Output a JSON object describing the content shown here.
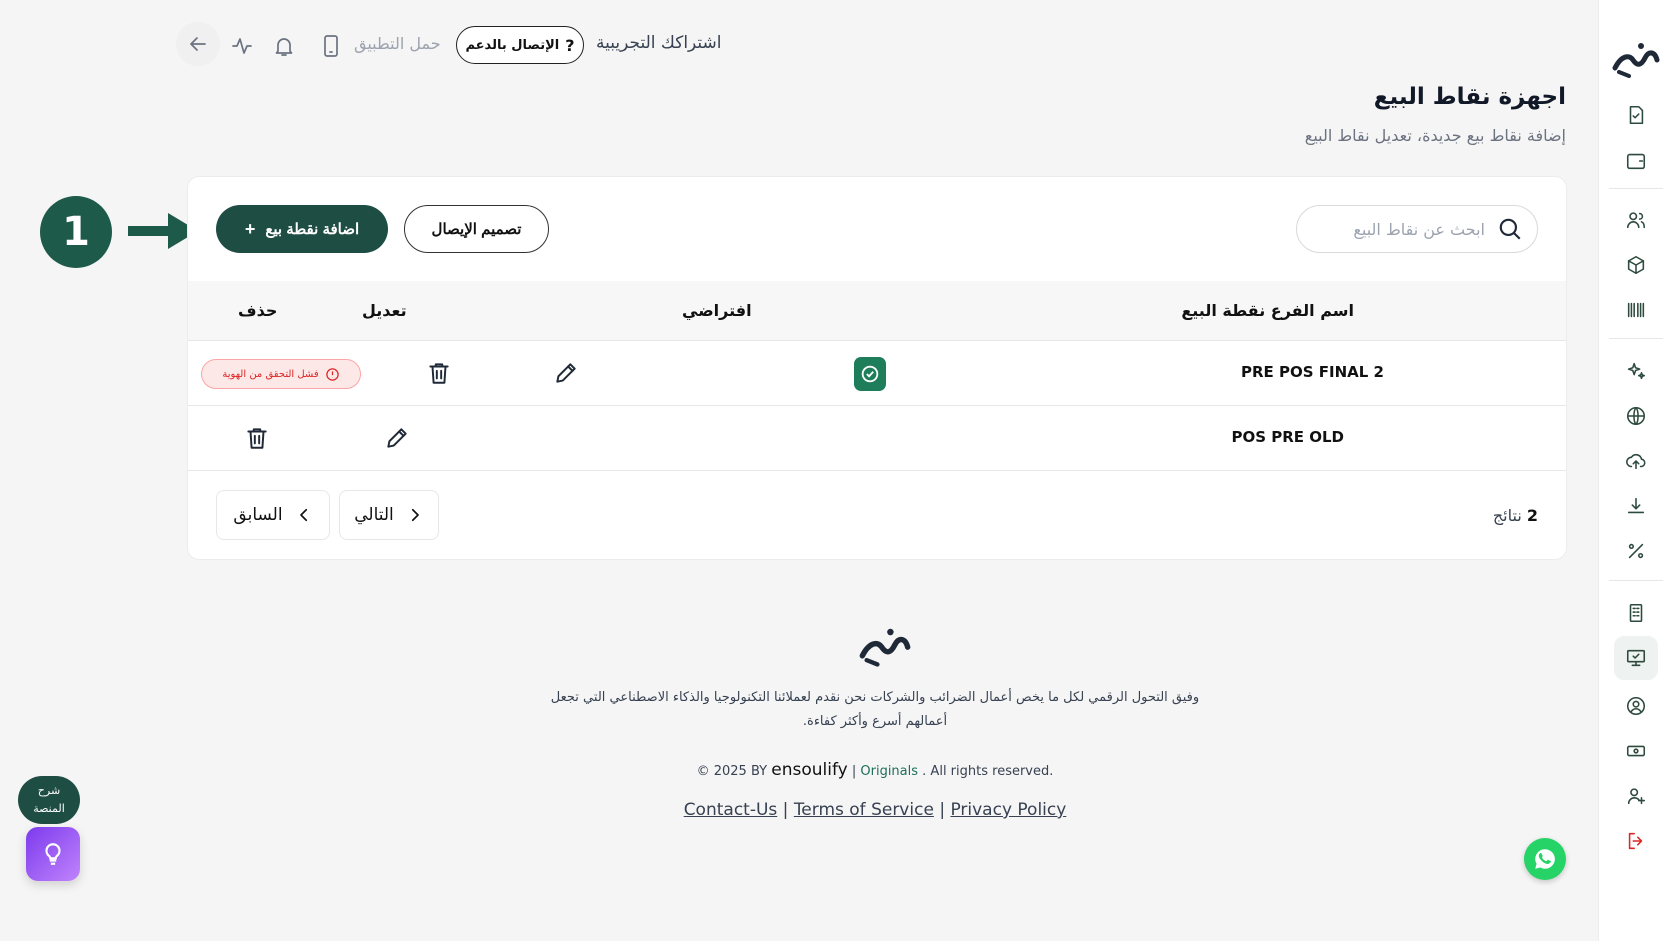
{
  "topbar": {
    "trial_text": "اشتراكك التجريبية",
    "support_label": "الإتصال بالدعم",
    "download_app_label": "حمل التطبيق",
    "icons": [
      "arrow-left-icon",
      "activity-icon",
      "bell-icon",
      "mobile-icon"
    ]
  },
  "header": {
    "title": "اجهزة نقاط البيع",
    "subtitle": "إضافة نقاط بيع جديدة، تعديل نقاط البيع"
  },
  "toolbar": {
    "search_placeholder": "ابحث عن نقاط البيع",
    "add_label": "اضافة نقطة بيع",
    "receipt_label": "تصميم الإيصال"
  },
  "table": {
    "columns": {
      "name": "اسم الفرع نقطة البيع",
      "default": "افتراضي",
      "edit": "تعديل",
      "delete": "حذف"
    },
    "rows": [
      {
        "name": "PRE POS FINAL 2",
        "is_default": true,
        "status": "فشل التحقق من الهوية"
      },
      {
        "name": "POS PRE OLD",
        "is_default": false,
        "status": ""
      }
    ]
  },
  "pagination": {
    "results_count": "2",
    "results_label": "نتائج",
    "next_label": "التالي",
    "prev_label": "السابق"
  },
  "annotation": {
    "step": "1"
  },
  "footer": {
    "description": "وفيق التحول الرقمي لكل ما يخص أعمال الضرائب والشركات نحن نقدم لعملائنا التكنولوجيا والذكاء الاصطناعي التي تجعل أعمالهم أسرع وأكثر كفاءة.",
    "copyright_prefix": "© 2025 BY",
    "brand": "ensoulify",
    "originals": "Originals",
    "rights": ". All rights reserved.",
    "links": [
      "Contact-Us",
      "Terms of Service",
      "Privacy Policy"
    ],
    "sep": "|"
  },
  "floating": {
    "help_label_line1": "شرح",
    "help_label_line2": "المنصة"
  },
  "colors": {
    "primary": "#1e4d44",
    "default_badge": "#1e7d5a",
    "error": "#dc2626",
    "whatsapp": "#25d366"
  }
}
